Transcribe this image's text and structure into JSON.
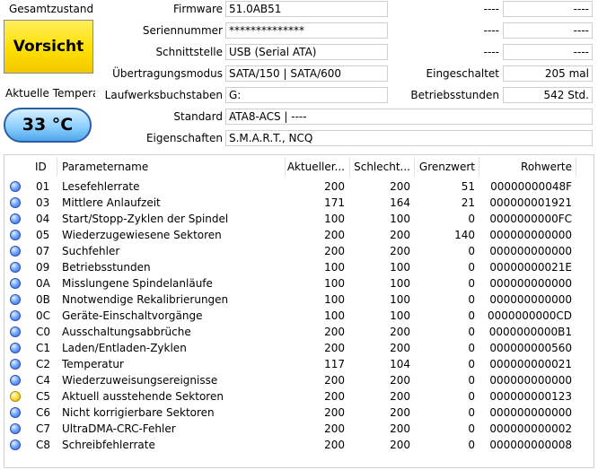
{
  "left": {
    "overall_label": "Gesamtzustand",
    "health_status": "Vorsicht",
    "temp_label": "Aktuelle Temperat",
    "temperature": "33 °C"
  },
  "info": [
    {
      "label": "Firmware",
      "value": "51.0AB51"
    },
    {
      "label": "Seriennummer",
      "value": "**************"
    },
    {
      "label": "Schnittstelle",
      "value": "USB (Serial ATA)"
    },
    {
      "label": "Übertragungsmodus",
      "value": "SATA/150 | SATA/600"
    },
    {
      "label": "Laufwerksbuchstaben",
      "value": "G:"
    },
    {
      "label": "Standard",
      "value": "ATA8-ACS | ----"
    },
    {
      "label": "Eigenschaften",
      "value": "S.M.A.R.T., NCQ"
    }
  ],
  "right": [
    {
      "label": "----",
      "value": "----"
    },
    {
      "label": "----",
      "value": "----"
    },
    {
      "label": "----",
      "value": "----"
    },
    {
      "label": "Eingeschaltet",
      "value": "205 mal"
    },
    {
      "label": "Betriebsstunden",
      "value": "542 Std."
    }
  ],
  "table": {
    "headers": [
      "ID",
      "Parametername",
      "Aktueller...",
      "Schlecht...",
      "Grenzwert",
      "Rohwerte"
    ],
    "rows": [
      {
        "status": "good",
        "id": "01",
        "name": "Lesefehlerrate",
        "current": "200",
        "worst": "200",
        "threshold": "51",
        "raw": "00000000048F"
      },
      {
        "status": "good",
        "id": "03",
        "name": "Mittlere Anlaufzeit",
        "current": "171",
        "worst": "164",
        "threshold": "21",
        "raw": "000000001921"
      },
      {
        "status": "good",
        "id": "04",
        "name": "Start/Stopp-Zyklen der Spindel",
        "current": "100",
        "worst": "100",
        "threshold": "0",
        "raw": "0000000000FC"
      },
      {
        "status": "good",
        "id": "05",
        "name": "Wiederzugewiesene Sektoren",
        "current": "200",
        "worst": "200",
        "threshold": "140",
        "raw": "000000000000"
      },
      {
        "status": "good",
        "id": "07",
        "name": "Suchfehler",
        "current": "200",
        "worst": "200",
        "threshold": "0",
        "raw": "000000000000"
      },
      {
        "status": "good",
        "id": "09",
        "name": "Betriebsstunden",
        "current": "100",
        "worst": "100",
        "threshold": "0",
        "raw": "00000000021E"
      },
      {
        "status": "good",
        "id": "0A",
        "name": "Misslungene Spindelanläufe",
        "current": "100",
        "worst": "100",
        "threshold": "0",
        "raw": "000000000000"
      },
      {
        "status": "good",
        "id": "0B",
        "name": "Nnotwendige Rekalibrierungen",
        "current": "100",
        "worst": "100",
        "threshold": "0",
        "raw": "000000000000"
      },
      {
        "status": "good",
        "id": "0C",
        "name": "Geräte-Einschaltvorgänge",
        "current": "100",
        "worst": "100",
        "threshold": "0",
        "raw": "0000000000CD"
      },
      {
        "status": "good",
        "id": "C0",
        "name": "Ausschaltungsabbrüche",
        "current": "200",
        "worst": "200",
        "threshold": "0",
        "raw": "0000000000B1"
      },
      {
        "status": "good",
        "id": "C1",
        "name": "Laden/Entladen-Zyklen",
        "current": "200",
        "worst": "200",
        "threshold": "0",
        "raw": "000000000560"
      },
      {
        "status": "good",
        "id": "C2",
        "name": "Temperatur",
        "current": "117",
        "worst": "104",
        "threshold": "0",
        "raw": "000000000021"
      },
      {
        "status": "good",
        "id": "C4",
        "name": "Wiederzuweisungsereignisse",
        "current": "200",
        "worst": "200",
        "threshold": "0",
        "raw": "000000000000"
      },
      {
        "status": "caution",
        "id": "C5",
        "name": "Aktuell ausstehende Sektoren",
        "current": "200",
        "worst": "200",
        "threshold": "0",
        "raw": "000000000123"
      },
      {
        "status": "good",
        "id": "C6",
        "name": "Nicht korrigierbare Sektoren",
        "current": "200",
        "worst": "200",
        "threshold": "0",
        "raw": "000000000000"
      },
      {
        "status": "good",
        "id": "C7",
        "name": "UltraDMA-CRC-Fehler",
        "current": "200",
        "worst": "200",
        "threshold": "0",
        "raw": "000000000002"
      },
      {
        "status": "good",
        "id": "C8",
        "name": "Schreibfehlerrate",
        "current": "200",
        "worst": "200",
        "threshold": "0",
        "raw": "000000000008"
      }
    ]
  }
}
